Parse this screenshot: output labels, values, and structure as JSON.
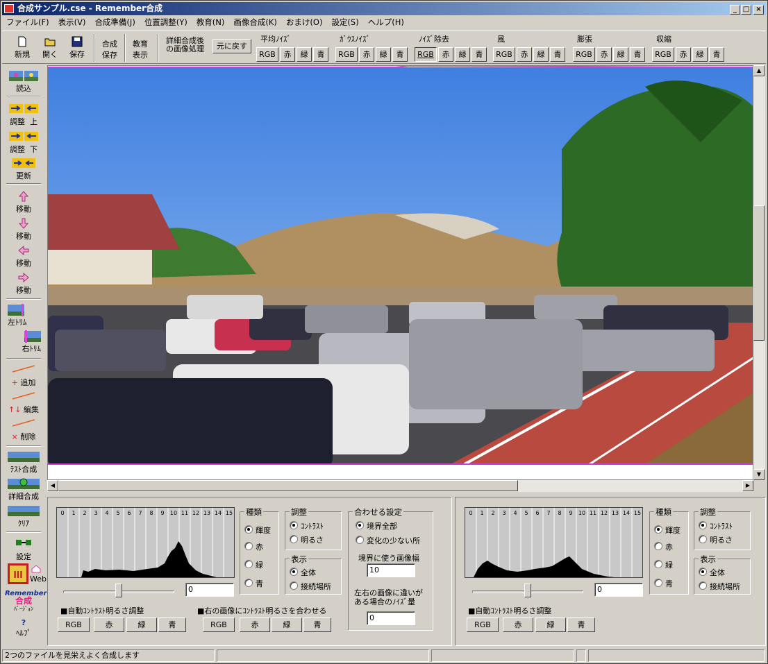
{
  "window": {
    "title": "合成サンプル.cse - Remember合成",
    "min": "_",
    "max": "□",
    "close": "×"
  },
  "menu": [
    "ファイル(F)",
    "表示(V)",
    "合成準備(J)",
    "位置調整(Y)",
    "教育(N)",
    "画像合成(K)",
    "おまけ(O)",
    "設定(S)",
    "ヘルプ(H)"
  ],
  "toolbar": {
    "new": "新規",
    "open": "開く",
    "save": "保存",
    "compose_save": [
      "合成",
      "保存"
    ],
    "edu_show": [
      "教育",
      "表示"
    ],
    "detail_after": [
      "詳細合成後",
      "の画像処理"
    ],
    "restore": "元に戻す",
    "groups": [
      {
        "label": "平均ﾉｲｽﾞ",
        "buttons": [
          "RGB",
          "赤",
          "緑",
          "青"
        ],
        "pressed": -1
      },
      {
        "label": "ｶﾞｳｽﾉｲｽﾞ",
        "buttons": [
          "RGB",
          "赤",
          "緑",
          "青"
        ],
        "pressed": -1
      },
      {
        "label": "ﾉｲｽﾞ除去",
        "buttons": [
          "RGB",
          "赤",
          "緑",
          "青"
        ],
        "pressed": 0
      },
      {
        "label": "風",
        "buttons": [
          "RGB",
          "赤",
          "緑",
          "青"
        ],
        "pressed": -1
      },
      {
        "label": "膨張",
        "buttons": [
          "RGB",
          "赤",
          "緑",
          "青"
        ],
        "pressed": -1
      },
      {
        "label": "収縮",
        "buttons": [
          "RGB",
          "赤",
          "緑",
          "青"
        ],
        "pressed": -1
      }
    ]
  },
  "sidebar": {
    "load": "読込",
    "adjust_up": [
      "調整",
      "上"
    ],
    "adjust_down": [
      "調整",
      "下"
    ],
    "update": "更新",
    "move": [
      "移動",
      "移動",
      "移動",
      "移動"
    ],
    "left_trim": "左ﾄﾘﾑ",
    "right_trim": "右ﾄﾘﾑ",
    "add": "追加",
    "edit": "編集",
    "delete": "削除",
    "test_compose": "ﾃｽﾄ合成",
    "detail_compose": "詳細合成",
    "clear": "ｸﾘｱ",
    "settings": "設定",
    "web": "Web",
    "version": [
      "Remember",
      "合成",
      "ﾊﾞｰｼﾞｮﾝ"
    ],
    "help": "ﾍﾙﾌﾟ"
  },
  "left_panel": {
    "hist_ticks": [
      "0",
      "1",
      "2",
      "3",
      "4",
      "5",
      "6",
      "7",
      "8",
      "9",
      "10",
      "11",
      "12",
      "13",
      "14",
      "15"
    ],
    "value": "0",
    "auto_label": "■自動ｺﾝﾄﾗｽﾄ明るさ調整",
    "match_label": "■右の画像にｺﾝﾄﾗｽﾄ明るさを合わせる",
    "kind": {
      "title": "種類",
      "options": [
        "輝度",
        "赤",
        "緑",
        "青"
      ],
      "selected": 0
    },
    "adjust": {
      "title": "調整",
      "options": [
        "ｺﾝﾄﾗｽﾄ",
        "明るさ"
      ],
      "selected": 0
    },
    "display": {
      "title": "表示",
      "options": [
        "全体",
        "接続場所"
      ],
      "selected": 0
    },
    "match": {
      "title": "合わせる設定",
      "options": [
        "境界全部",
        "変化の少ない所"
      ],
      "selected": 0
    },
    "border_width_label": "境界に使う画像幅",
    "border_width": "10",
    "noise_label": [
      "左右の画像に違いが",
      "ある場合のﾉｲｽﾞ量"
    ],
    "noise": "0",
    "buttons_a": [
      "RGB",
      "赤",
      "緑",
      "青"
    ],
    "buttons_b": [
      "RGB",
      "赤",
      "緑",
      "青"
    ]
  },
  "right_panel": {
    "hist_ticks": [
      "0",
      "1",
      "2",
      "3",
      "4",
      "5",
      "6",
      "7",
      "8",
      "9",
      "10",
      "11",
      "12",
      "13",
      "14",
      "15"
    ],
    "value": "0",
    "auto_label": "■自動ｺﾝﾄﾗｽﾄ明るさ調整",
    "kind": {
      "title": "種類",
      "options": [
        "輝度",
        "赤",
        "緑",
        "青"
      ],
      "selected": 0
    },
    "adjust": {
      "title": "調整",
      "options": [
        "ｺﾝﾄﾗｽﾄ",
        "明るさ"
      ],
      "selected": 0
    },
    "display": {
      "title": "表示",
      "options": [
        "全体",
        "接続場所"
      ],
      "selected": 0
    },
    "buttons": [
      "RGB",
      "赤",
      "緑",
      "青"
    ]
  },
  "status": {
    "message": "2つのファイルを見栄えよく合成します"
  },
  "colors": {
    "title_start": "#0a246a",
    "title_end": "#a6caf0",
    "chrome": "#d4d0c8",
    "sky": "#5d93e6",
    "track": "#b84a40"
  }
}
